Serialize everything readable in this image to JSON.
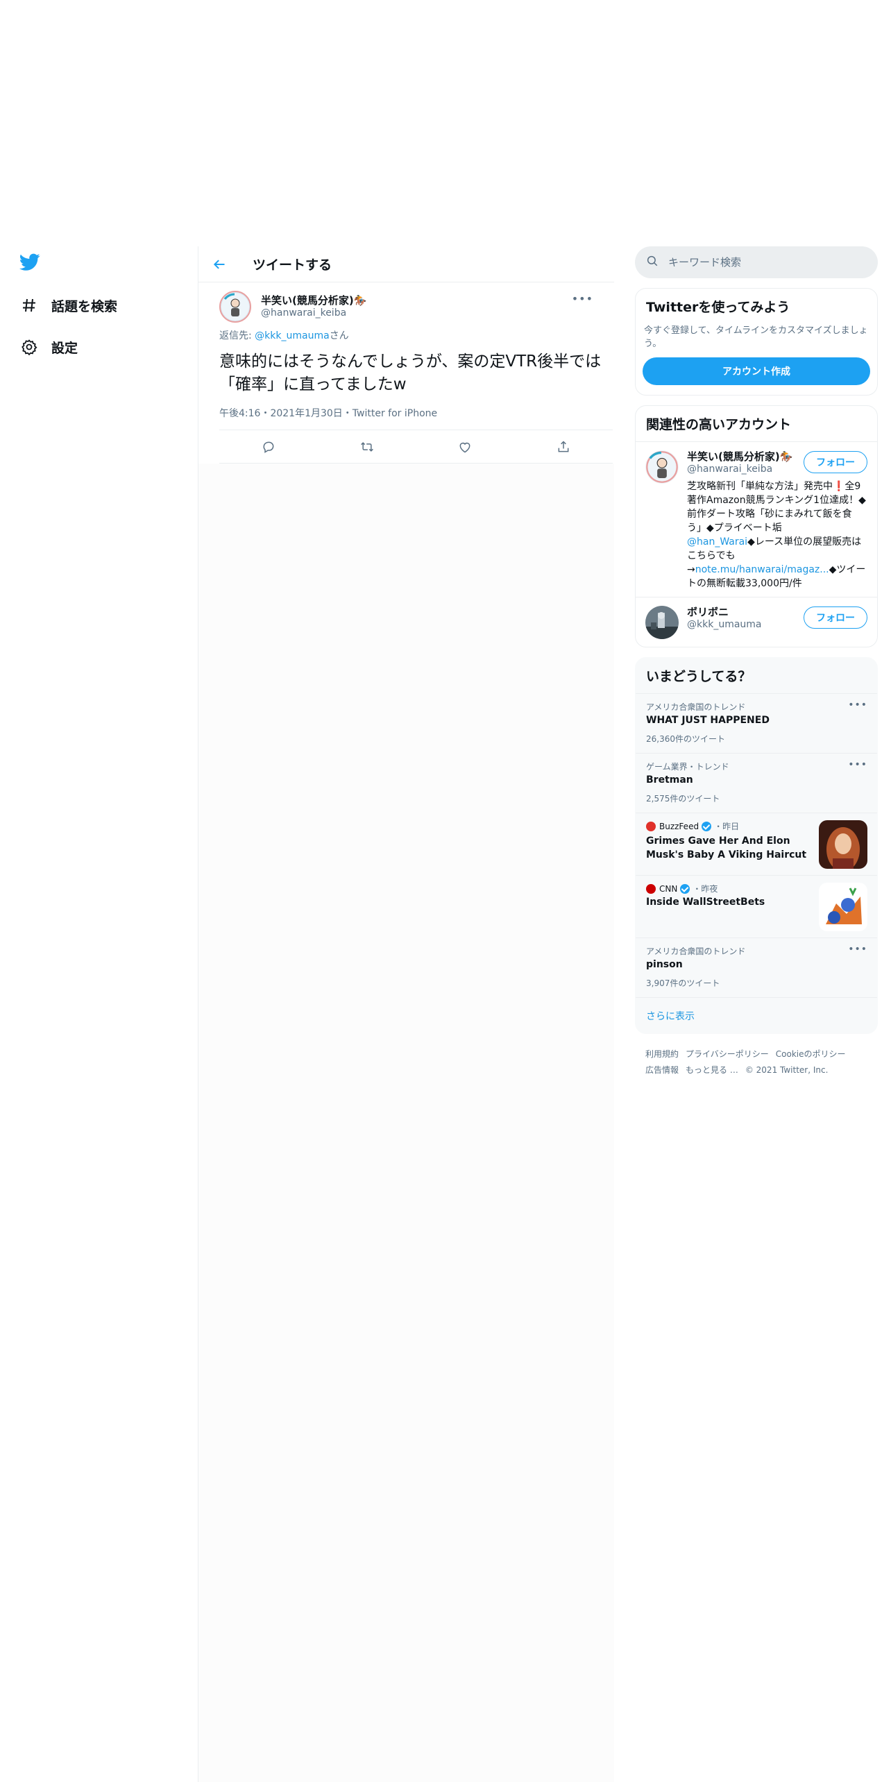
{
  "nav": {
    "items": [
      {
        "label": "話題を検索",
        "icon": "hashtag-icon"
      },
      {
        "label": "設定",
        "icon": "gear-icon"
      }
    ]
  },
  "header": {
    "title": "ツイートする"
  },
  "tweet": {
    "name": "半笑い(競馬分析家)🏇",
    "handle": "@hanwarai_keiba",
    "reply_prefix": "返信先: ",
    "reply_handle": "@kkk_umauma",
    "reply_suffix": "さん",
    "text": "意味的にはそうなんでしょうが、案の定VTR後半では「確率」に直ってましたw",
    "meta": "午後4:16・2021年1月30日・Twitter for iPhone"
  },
  "search": {
    "placeholder": "キーワード検索"
  },
  "signup": {
    "title": "Twitterを使ってみよう",
    "desc": "今すぐ登録して、タイムラインをカスタマイズしましょう。",
    "button": "アカウント作成"
  },
  "related": {
    "title": "関連性の高いアカウント",
    "accounts": [
      {
        "name": "半笑い(競馬分析家)🏇",
        "handle": "@hanwarai_keiba",
        "follow": "フォロー",
        "bio_1": "芝攻略新刊「単純な方法」発売中❗️全9著作Amazon競馬ランキング1位達成！◆前作ダート攻略「砂にまみれて飯を食う」◆プライベート垢",
        "bio_link1": "@han_Warai",
        "bio_2": "◆レース単位の展望販売はこちらでも→",
        "bio_link2": "note.mu/hanwarai/magaz...",
        "bio_3": "◆ツイートの無断転載33,000円/件"
      },
      {
        "name": "ボリボニ",
        "handle": "@kkk_umauma",
        "follow": "フォロー"
      }
    ]
  },
  "trends": {
    "title": "いまどうしてる？",
    "items": [
      {
        "context": "アメリカ合衆国のトレンド",
        "title": "WHAT JUST HAPPENED",
        "count": "26,360件のツイート"
      },
      {
        "context": "ゲーム業界・トレンド",
        "title": "Bretman",
        "count": "2,575件のツイート"
      },
      {
        "source": "BuzzFeed",
        "time": "・昨日",
        "title": "Grimes Gave Her And Elon Musk's Baby A Viking Haircut"
      },
      {
        "source": "CNN",
        "time": "・昨夜",
        "title": "Inside WallStreetBets"
      },
      {
        "context": "アメリカ合衆国のトレンド",
        "title": "pinson",
        "count": "3,907件のツイート"
      }
    ],
    "show_more": "さらに表示"
  },
  "footer": {
    "links": [
      "利用規約",
      "プライバシーポリシー",
      "Cookieのポリシー",
      "広告情報",
      "もっと見る …",
      "© 2021 Twitter, Inc."
    ]
  },
  "colors": {
    "accent": "#1da1f2",
    "link": "#1b95e0",
    "muted": "#5b7083"
  }
}
